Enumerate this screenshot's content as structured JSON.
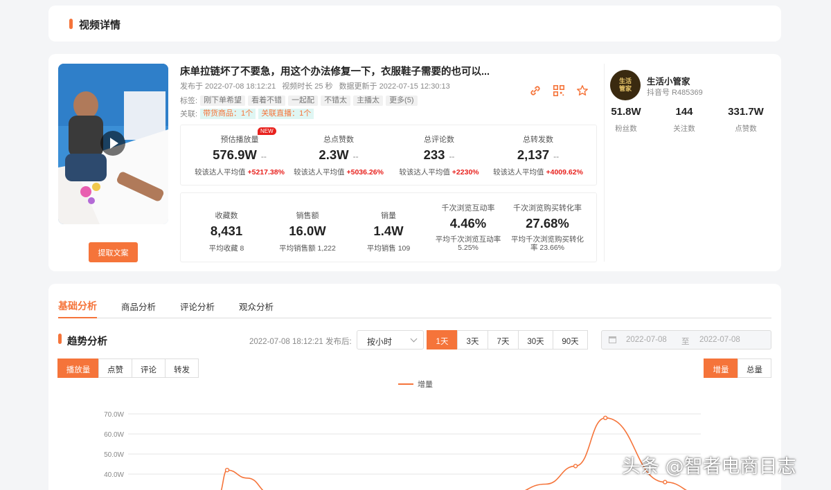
{
  "header": {
    "title": "视频详情"
  },
  "video": {
    "title": "床单拉链坏了不要急，用这个办法修复一下，衣服鞋子需要的也可以...",
    "publish_label": "发布于 2022-07-08 18:12:21",
    "duration_label": "视频时长 25 秒",
    "update_label": "数据更新于 2022-07-15 12:30:13",
    "tags_label": "标签:",
    "tags": [
      "刚下单希望",
      "看着不错",
      "一起配",
      "不错太",
      "主播太",
      "更多(5)"
    ],
    "links_label": "关联:",
    "link_goods": "带货商品：1个",
    "link_live": "关联直播：1个",
    "extract_button": "提取文案"
  },
  "stats_top": [
    {
      "label": "预估播放量",
      "value": "576.9W",
      "dash": "--",
      "sub": "较该达人平均值",
      "pct": "+5217.38%",
      "badge": "NEW"
    },
    {
      "label": "总点赞数",
      "value": "2.3W",
      "dash": "--",
      "sub": "较该达人平均值",
      "pct": "+5036.26%"
    },
    {
      "label": "总评论数",
      "value": "233",
      "dash": "--",
      "sub": "较该达人平均值",
      "pct": "+2230%"
    },
    {
      "label": "总转发数",
      "value": "2,137",
      "dash": "--",
      "sub": "较该达人平均值",
      "pct": "+4009.62%"
    }
  ],
  "stats_bottom": [
    {
      "label": "收藏数",
      "value": "8,431",
      "sub": "平均收藏 8"
    },
    {
      "label": "销售额",
      "value": "16.0W",
      "sub": "平均销售额 1,222"
    },
    {
      "label": "销量",
      "value": "1.4W",
      "sub": "平均销售 109"
    },
    {
      "label": "千次浏览互动率",
      "value": "4.46%",
      "sub1": "平均千次浏览互动率",
      "sub2": "5.25%"
    },
    {
      "label": "千次浏览购买转化率",
      "value": "27.68%",
      "sub1": "平均千次浏览购买转化",
      "sub2": "率 23.66%"
    }
  ],
  "author": {
    "avatar_text_1": "生活",
    "avatar_text_2": "管家",
    "name": "生活小管家",
    "id": "抖音号 R485369",
    "fans_value": "51.8W",
    "fans_label": "粉丝数",
    "following_value": "144",
    "following_label": "关注数",
    "likes_value": "331.7W",
    "likes_label": "点赞数"
  },
  "analysis": {
    "tabs": [
      "基础分析",
      "商品分析",
      "评论分析",
      "观众分析"
    ],
    "trend_title": "趋势分析",
    "publish_after": "2022-07-08 18:12:21 发布后:",
    "granularity": "按小时",
    "ranges": [
      "1天",
      "3天",
      "7天",
      "30天",
      "90天"
    ],
    "date_from": "2022-07-08",
    "date_sep": "至",
    "date_to": "2022-07-08",
    "metrics": [
      "播放量",
      "点赞",
      "评论",
      "转发"
    ],
    "modes": [
      "增量",
      "总量"
    ]
  },
  "chart_data": {
    "type": "line",
    "series": [
      {
        "name": "增量",
        "points": [
          [
            0.76,
            30
          ],
          [
            0.83,
            42
          ],
          [
            1.0,
            38
          ],
          [
            1.2,
            30
          ],
          [
            3.2,
            30
          ],
          [
            3.5,
            35
          ],
          [
            3.75,
            44
          ],
          [
            4.0,
            68
          ],
          [
            4.5,
            36
          ],
          [
            4.8,
            30
          ]
        ]
      }
    ],
    "y_ticks": [
      "40.0W",
      "50.0W",
      "60.0W",
      "70.0W"
    ],
    "ylim": [
      30,
      70
    ],
    "color": "#f5743a"
  },
  "watermark": "头条 @智者电商日志"
}
